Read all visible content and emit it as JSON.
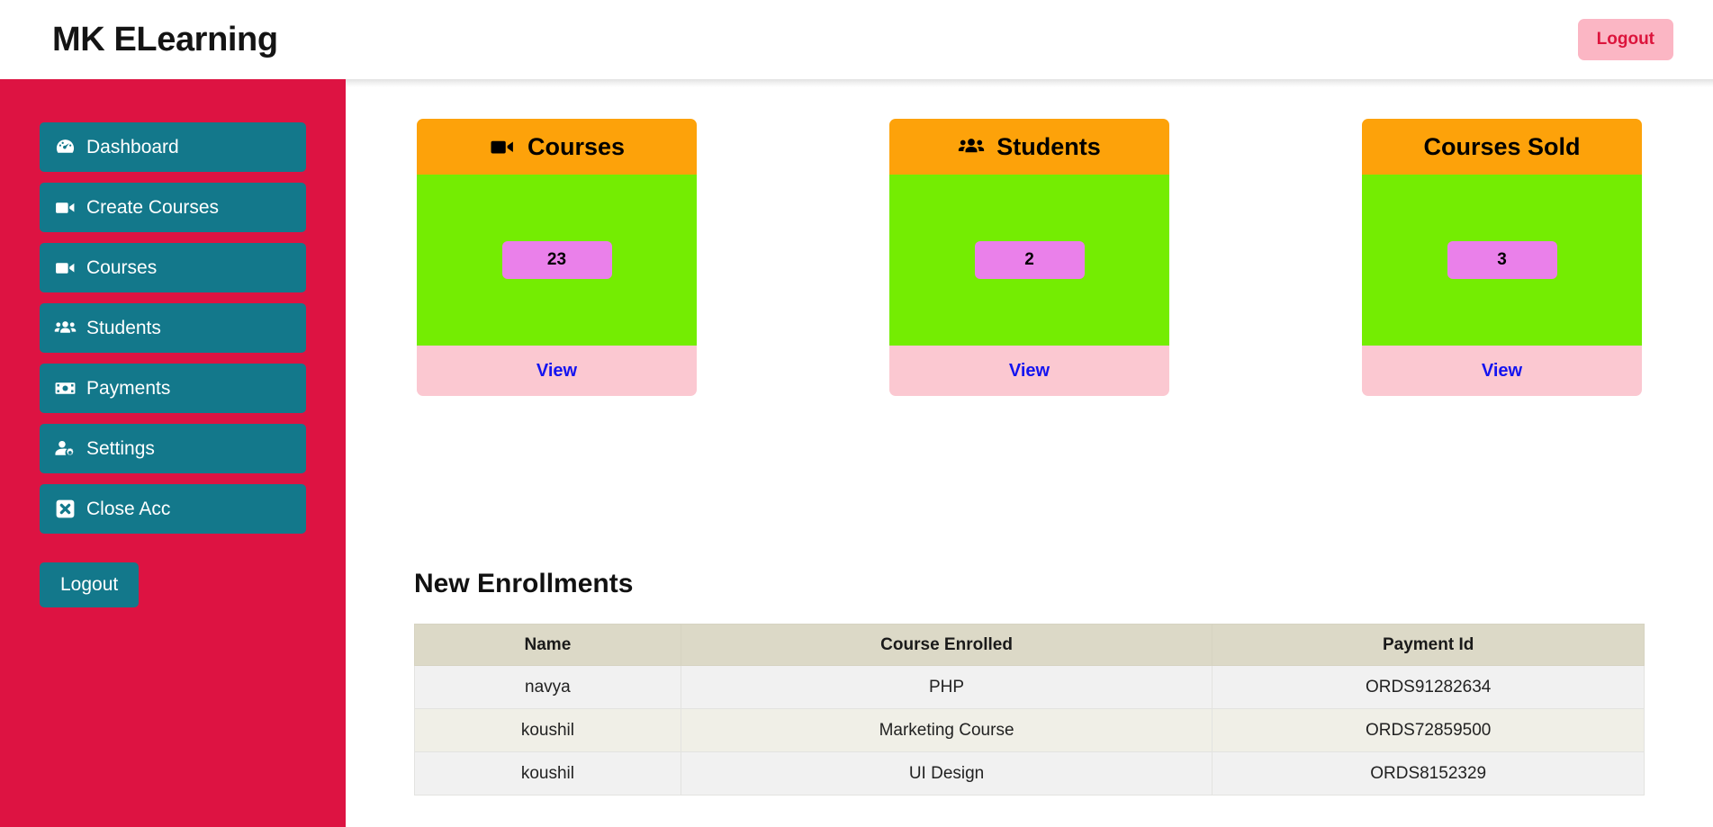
{
  "header": {
    "brand": "MK ELearning",
    "logout_label": "Logout"
  },
  "sidebar": {
    "logout_label": "Logout",
    "items": [
      {
        "label": "Dashboard",
        "icon": "tachometer-icon"
      },
      {
        "label": "Create Courses",
        "icon": "video-camera-icon"
      },
      {
        "label": "Courses",
        "icon": "video-camera-icon"
      },
      {
        "label": "Students",
        "icon": "users-group-icon"
      },
      {
        "label": "Payments",
        "icon": "money-bill-icon"
      },
      {
        "label": "Settings",
        "icon": "user-gear-icon"
      },
      {
        "label": "Close Acc",
        "icon": "square-x-icon"
      }
    ]
  },
  "cards": [
    {
      "title": "Courses",
      "icon": "video-camera-icon",
      "value": "23",
      "action": "View"
    },
    {
      "title": "Students",
      "icon": "users-group-icon",
      "value": "2",
      "action": "View"
    },
    {
      "title": "Courses Sold",
      "icon": "none",
      "value": "3",
      "action": "View"
    }
  ],
  "enrollments": {
    "heading": "New Enrollments",
    "columns": [
      "Name",
      "Course Enrolled",
      "Payment Id"
    ],
    "rows": [
      {
        "name": "navya",
        "course": "PHP",
        "payment": "ORDS91282634"
      },
      {
        "name": "koushil",
        "course": "Marketing Course",
        "payment": "ORDS72859500"
      },
      {
        "name": "koushil",
        "course": "UI Design",
        "payment": "ORDS8152329"
      }
    ]
  },
  "colors": {
    "sidebar_bg": "#dd1342",
    "nav_item_bg": "#13788b",
    "card_header": "#fda20a",
    "card_body": "#74ed02",
    "card_badge": "#ea80ea",
    "card_footer": "#fbc8d1",
    "view_link": "#1414f0",
    "logout_top_bg": "#fbb6c4",
    "logout_top_text": "#dc143c",
    "table_header_bg": "#dcd9c7"
  }
}
